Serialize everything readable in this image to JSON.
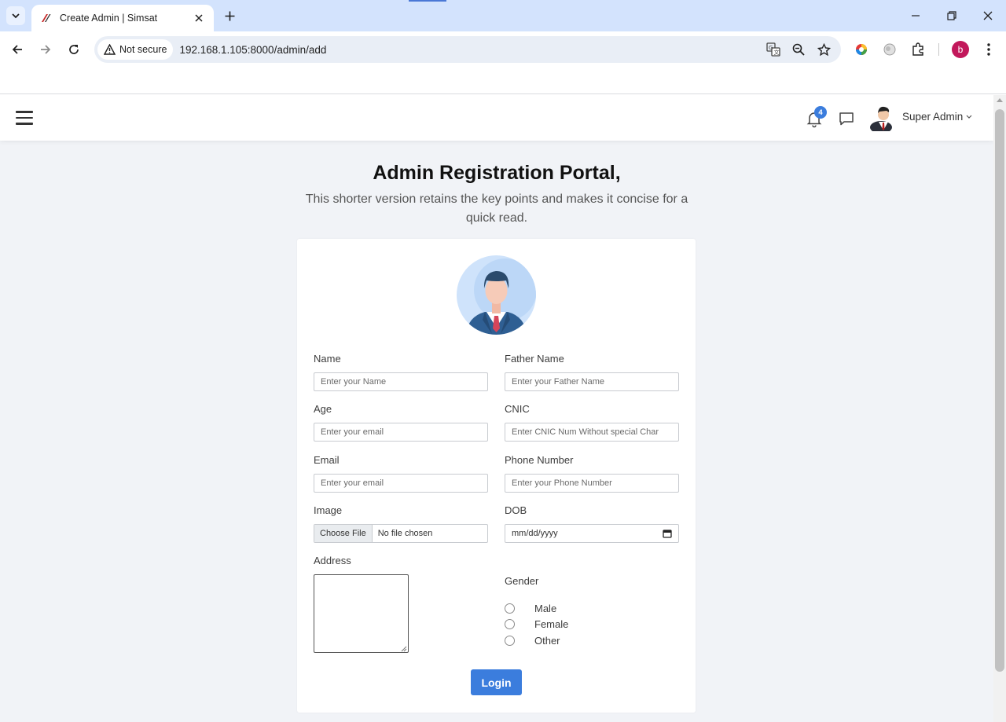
{
  "browser": {
    "tab_title": "Create Admin | Simsat",
    "security_label": "Not secure",
    "url": "192.168.1.105:8000/admin/add",
    "profile_initial": "b"
  },
  "header": {
    "notification_count": "4",
    "user_name": "Super Admin"
  },
  "page": {
    "title": "Admin Registration Portal,",
    "subtitle": "This shorter version retains the key points and makes it concise for a quick read."
  },
  "form": {
    "name_label": "Name",
    "name_placeholder": "Enter your Name",
    "father_label": "Father Name",
    "father_placeholder": "Enter your Father Name",
    "age_label": "Age",
    "age_placeholder": "Enter your email",
    "cnic_label": "CNIC",
    "cnic_placeholder": "Enter CNIC Num Without special Char",
    "email_label": "Email",
    "email_placeholder": "Enter your email",
    "phone_label": "Phone Number",
    "phone_placeholder": "Enter your Phone Number",
    "image_label": "Image",
    "file_button": "Choose File",
    "file_status": "No file chosen",
    "dob_label": "DOB",
    "dob_placeholder": "mm/dd/yyyy",
    "address_label": "Address",
    "gender_label": "Gender",
    "gender_options": [
      "Male",
      "Female",
      "Other"
    ],
    "submit_label": "Login"
  },
  "colors": {
    "accent": "#3b7ddd",
    "page_background": "#f1f3f7",
    "tabstrip": "#d3e3fd"
  }
}
